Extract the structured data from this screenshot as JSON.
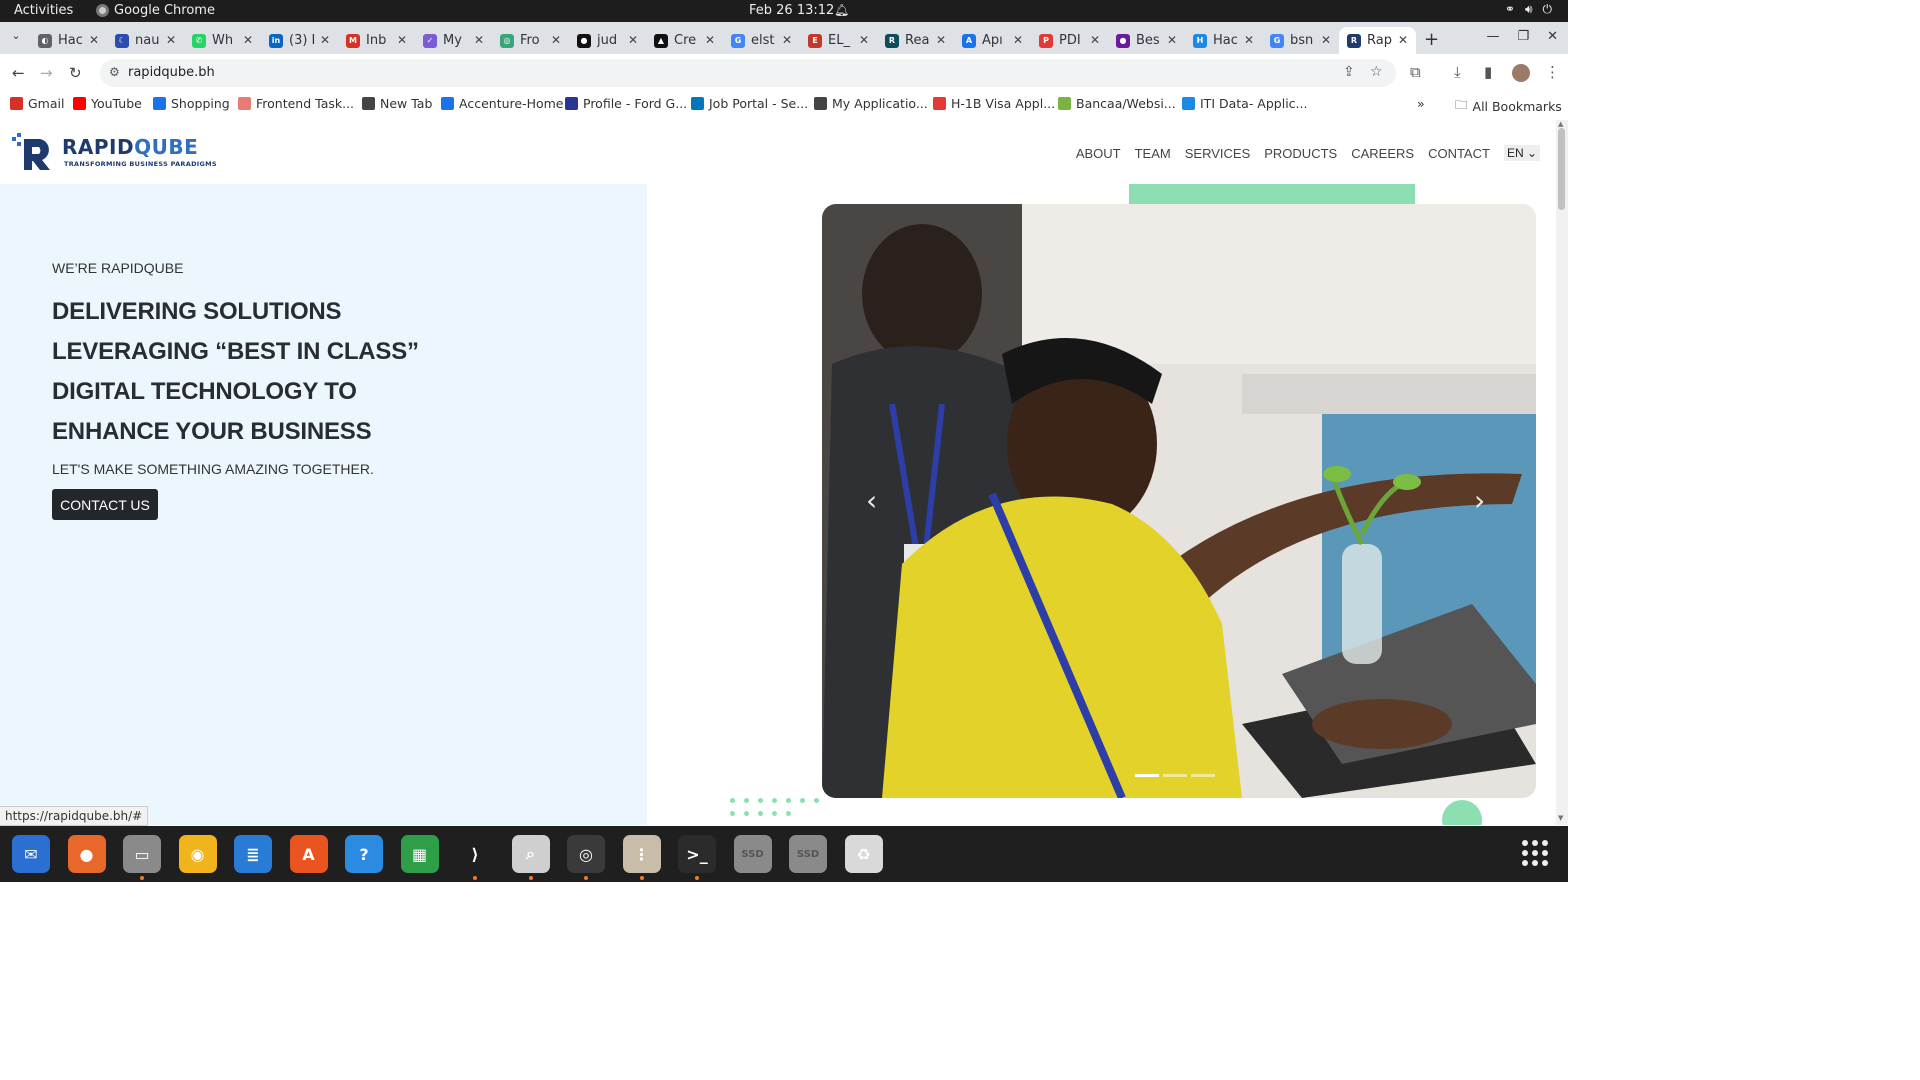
{
  "system": {
    "activities": "Activities",
    "app_name": "Google Chrome",
    "clock": "Feb 26  13:12"
  },
  "tabs": [
    {
      "label": "Hac",
      "color": "#5f6368",
      "glyph": "◐"
    },
    {
      "label": "nau",
      "color": "#2b4bb0",
      "glyph": "☾"
    },
    {
      "label": "Wh",
      "color": "#25d366",
      "glyph": "✆"
    },
    {
      "label": "(3) I",
      "color": "#0a66c2",
      "glyph": "in"
    },
    {
      "label": "Inb",
      "color": "#d93025",
      "glyph": "M"
    },
    {
      "label": "My",
      "color": "#7b5cd6",
      "glyph": "✓"
    },
    {
      "label": "Fro",
      "color": "#3aa57a",
      "glyph": "◎"
    },
    {
      "label": "jud",
      "color": "#111111",
      "glyph": "●"
    },
    {
      "label": "Cre",
      "color": "#111111",
      "glyph": "▲"
    },
    {
      "label": "elst",
      "color": "#4285f4",
      "glyph": "G"
    },
    {
      "label": "EL_",
      "color": "#c0392b",
      "glyph": "E"
    },
    {
      "label": "Rea",
      "color": "#0f4c5c",
      "glyph": "R"
    },
    {
      "label": "Apı",
      "color": "#1a73e8",
      "glyph": "A"
    },
    {
      "label": "PDI",
      "color": "#e53935",
      "glyph": "P"
    },
    {
      "label": "Bes",
      "color": "#6a1b9a",
      "glyph": "●"
    },
    {
      "label": "Hac",
      "color": "#1e88e5",
      "glyph": "H"
    },
    {
      "label": "bsn",
      "color": "#4285f4",
      "glyph": "G"
    },
    {
      "label": "Rap",
      "color": "#1e3a6e",
      "glyph": "R",
      "active": true
    }
  ],
  "address_bar": {
    "url": "rapidqube.bh"
  },
  "bookmarks": [
    {
      "label": "Gmail",
      "color": "#d93025"
    },
    {
      "label": "YouTube",
      "color": "#ff0000"
    },
    {
      "label": "Shopping",
      "color": "#1a73e8"
    },
    {
      "label": "Frontend Task...",
      "color": "#e67c73"
    },
    {
      "label": "New Tab",
      "color": "#444444"
    },
    {
      "label": "Accenture-Home",
      "color": "#1a73e8"
    },
    {
      "label": "Profile - Ford G...",
      "color": "#283593"
    },
    {
      "label": "Job Portal - Se...",
      "color": "#0277bd"
    },
    {
      "label": "My Applicatio...",
      "color": "#444444"
    },
    {
      "label": "H-1B Visa Appl...",
      "color": "#e53935"
    },
    {
      "label": "Bancaa/Websi...",
      "color": "#7cb342"
    },
    {
      "label": "ITI Data- Applic...",
      "color": "#1e88e5"
    }
  ],
  "all_bookmarks": "All Bookmarks",
  "site": {
    "logo_name_1": "RAPID",
    "logo_name_2": "QUBE",
    "logo_tagline": "TRANSFORMING BUSINESS PARADIGMS",
    "nav": [
      "ABOUT",
      "TEAM",
      "SERVICES",
      "PRODUCTS",
      "CAREERS",
      "CONTACT"
    ],
    "language": "EN",
    "hero": {
      "kicker": "WE’RE RAPIDQUBE",
      "headline_lines": [
        "DELIVERING SOLUTIONS",
        "LEVERAGING “BEST IN CLASS”",
        "DIGITAL TECHNOLOGY TO",
        "ENHANCE YOUR BUSINESS"
      ],
      "subline": "LET'S MAKE SOMETHING AMAZING TOGETHER.",
      "cta_label": "CONTACT US"
    },
    "carousel": {
      "slides": 3,
      "active_slide": 1
    }
  },
  "status_url": "https://rapidqube.bh/#",
  "dock_apps": [
    {
      "name": "thunderbird",
      "color": "#2a6fd1",
      "glyph": "✉",
      "running": false
    },
    {
      "name": "firefox",
      "color": "#e8672a",
      "glyph": "●",
      "running": false
    },
    {
      "name": "files",
      "color": "#8a8a8a",
      "glyph": "▭",
      "running": true
    },
    {
      "name": "rhythmbox",
      "color": "#f2b41c",
      "glyph": "◉",
      "running": false
    },
    {
      "name": "writer",
      "color": "#2a7bd6",
      "glyph": "≣",
      "running": false
    },
    {
      "name": "app-center",
      "color": "#e95420",
      "glyph": "A",
      "running": false
    },
    {
      "name": "help",
      "color": "#2a8be0",
      "glyph": "?",
      "running": false
    },
    {
      "name": "calc",
      "color": "#2e9e48",
      "glyph": "▦",
      "running": false
    },
    {
      "name": "vscode",
      "color": "#1f1f1f",
      "glyph": "⟩",
      "running": true
    },
    {
      "name": "image-viewer",
      "color": "#cfcfcf",
      "glyph": "⌕",
      "running": true
    },
    {
      "name": "chrome",
      "color": "#3a3a3a",
      "glyph": "◎",
      "running": true
    },
    {
      "name": "archive",
      "color": "#c8bda8",
      "glyph": "⋮",
      "running": true
    },
    {
      "name": "terminal",
      "color": "#2b2b2b",
      "glyph": ">_",
      "running": true
    },
    {
      "name": "ssd-1",
      "color": "#8a8a8a",
      "glyph": "SSD",
      "running": false
    },
    {
      "name": "ssd-2",
      "color": "#8a8a8a",
      "glyph": "SSD",
      "running": false
    },
    {
      "name": "trash",
      "color": "#d9d9d9",
      "glyph": "♻",
      "running": false
    }
  ]
}
